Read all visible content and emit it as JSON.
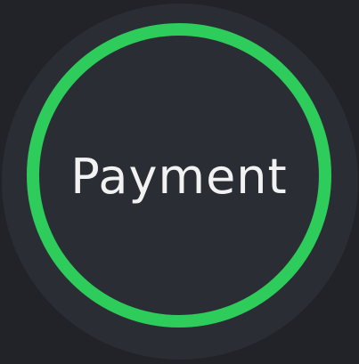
{
  "payment_button": {
    "label": "Payment",
    "ring_color": "#2ecc5b",
    "background_color": "#2a2e34",
    "page_background": "#212328"
  }
}
